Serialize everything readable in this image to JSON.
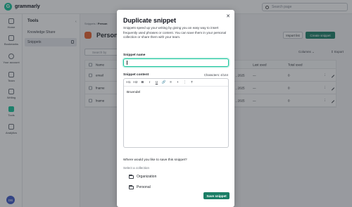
{
  "app": {
    "logo_text": "grammarly",
    "logo_letter": "G",
    "brand_color": "#15c39a",
    "accent_color": "#1a7e66"
  },
  "topbar": {
    "search_placeholder": "Search page"
  },
  "rail": {
    "items": [
      {
        "label": "Home",
        "icon": "home-icon"
      },
      {
        "label": "Bookmarks",
        "icon": "bookmark-icon"
      },
      {
        "label": "Your account",
        "icon": "account-icon"
      },
      {
        "label": "Team",
        "icon": "team-icon"
      },
      {
        "label": "Writing",
        "icon": "pen-icon"
      },
      {
        "label": "Tools",
        "icon": "tools-icon"
      },
      {
        "label": "Analytics",
        "icon": "analytics-icon"
      }
    ],
    "avatar_initials": "DB"
  },
  "panel": {
    "title": "Tools",
    "items": [
      {
        "label": "Knowledge Share"
      },
      {
        "label": "Snippets"
      }
    ]
  },
  "main": {
    "breadcrumb_parent": "Snippets",
    "breadcrumb_current": "Person",
    "title": "Person",
    "import_label": "Import list",
    "create_label": "Create snippet",
    "search_placeholder": "Search by",
    "columns_label": "Columns",
    "export_label": "Export",
    "table": {
      "headers": [
        "Name",
        "Last used",
        "Total used"
      ],
      "rows": [
        {
          "name": "email",
          "date": ", 2025",
          "last_used": "—",
          "total": "0"
        },
        {
          "name": "fname",
          "date": ", 2025",
          "last_used": "—",
          "total": "0"
        },
        {
          "name": "lname",
          "date": ", 2025",
          "last_used": "—",
          "total": "0"
        }
      ]
    }
  },
  "modal": {
    "title": "Duplicate snippet",
    "description": "Snippets speed up your writing by giving you an easy way to insert frequently used phrases or content. You can save them in your personal collection or share them with your team.",
    "name_label": "Snippet name",
    "name_value": "",
    "content_label": "Snippet content",
    "char_count": "Characters: 4/144",
    "toolbar": [
      "H1",
      "H2",
      "B",
      "I",
      "U",
      "🔗",
      "≡",
      "•",
      "⋮",
      "T"
    ],
    "content_value": "Bruendel",
    "save_question": "Where would you like to save this snippet?",
    "select_label": "Select a collection",
    "collections": [
      {
        "label": "Organization"
      },
      {
        "label": "Personal"
      }
    ],
    "save_label": "Save snippet"
  }
}
